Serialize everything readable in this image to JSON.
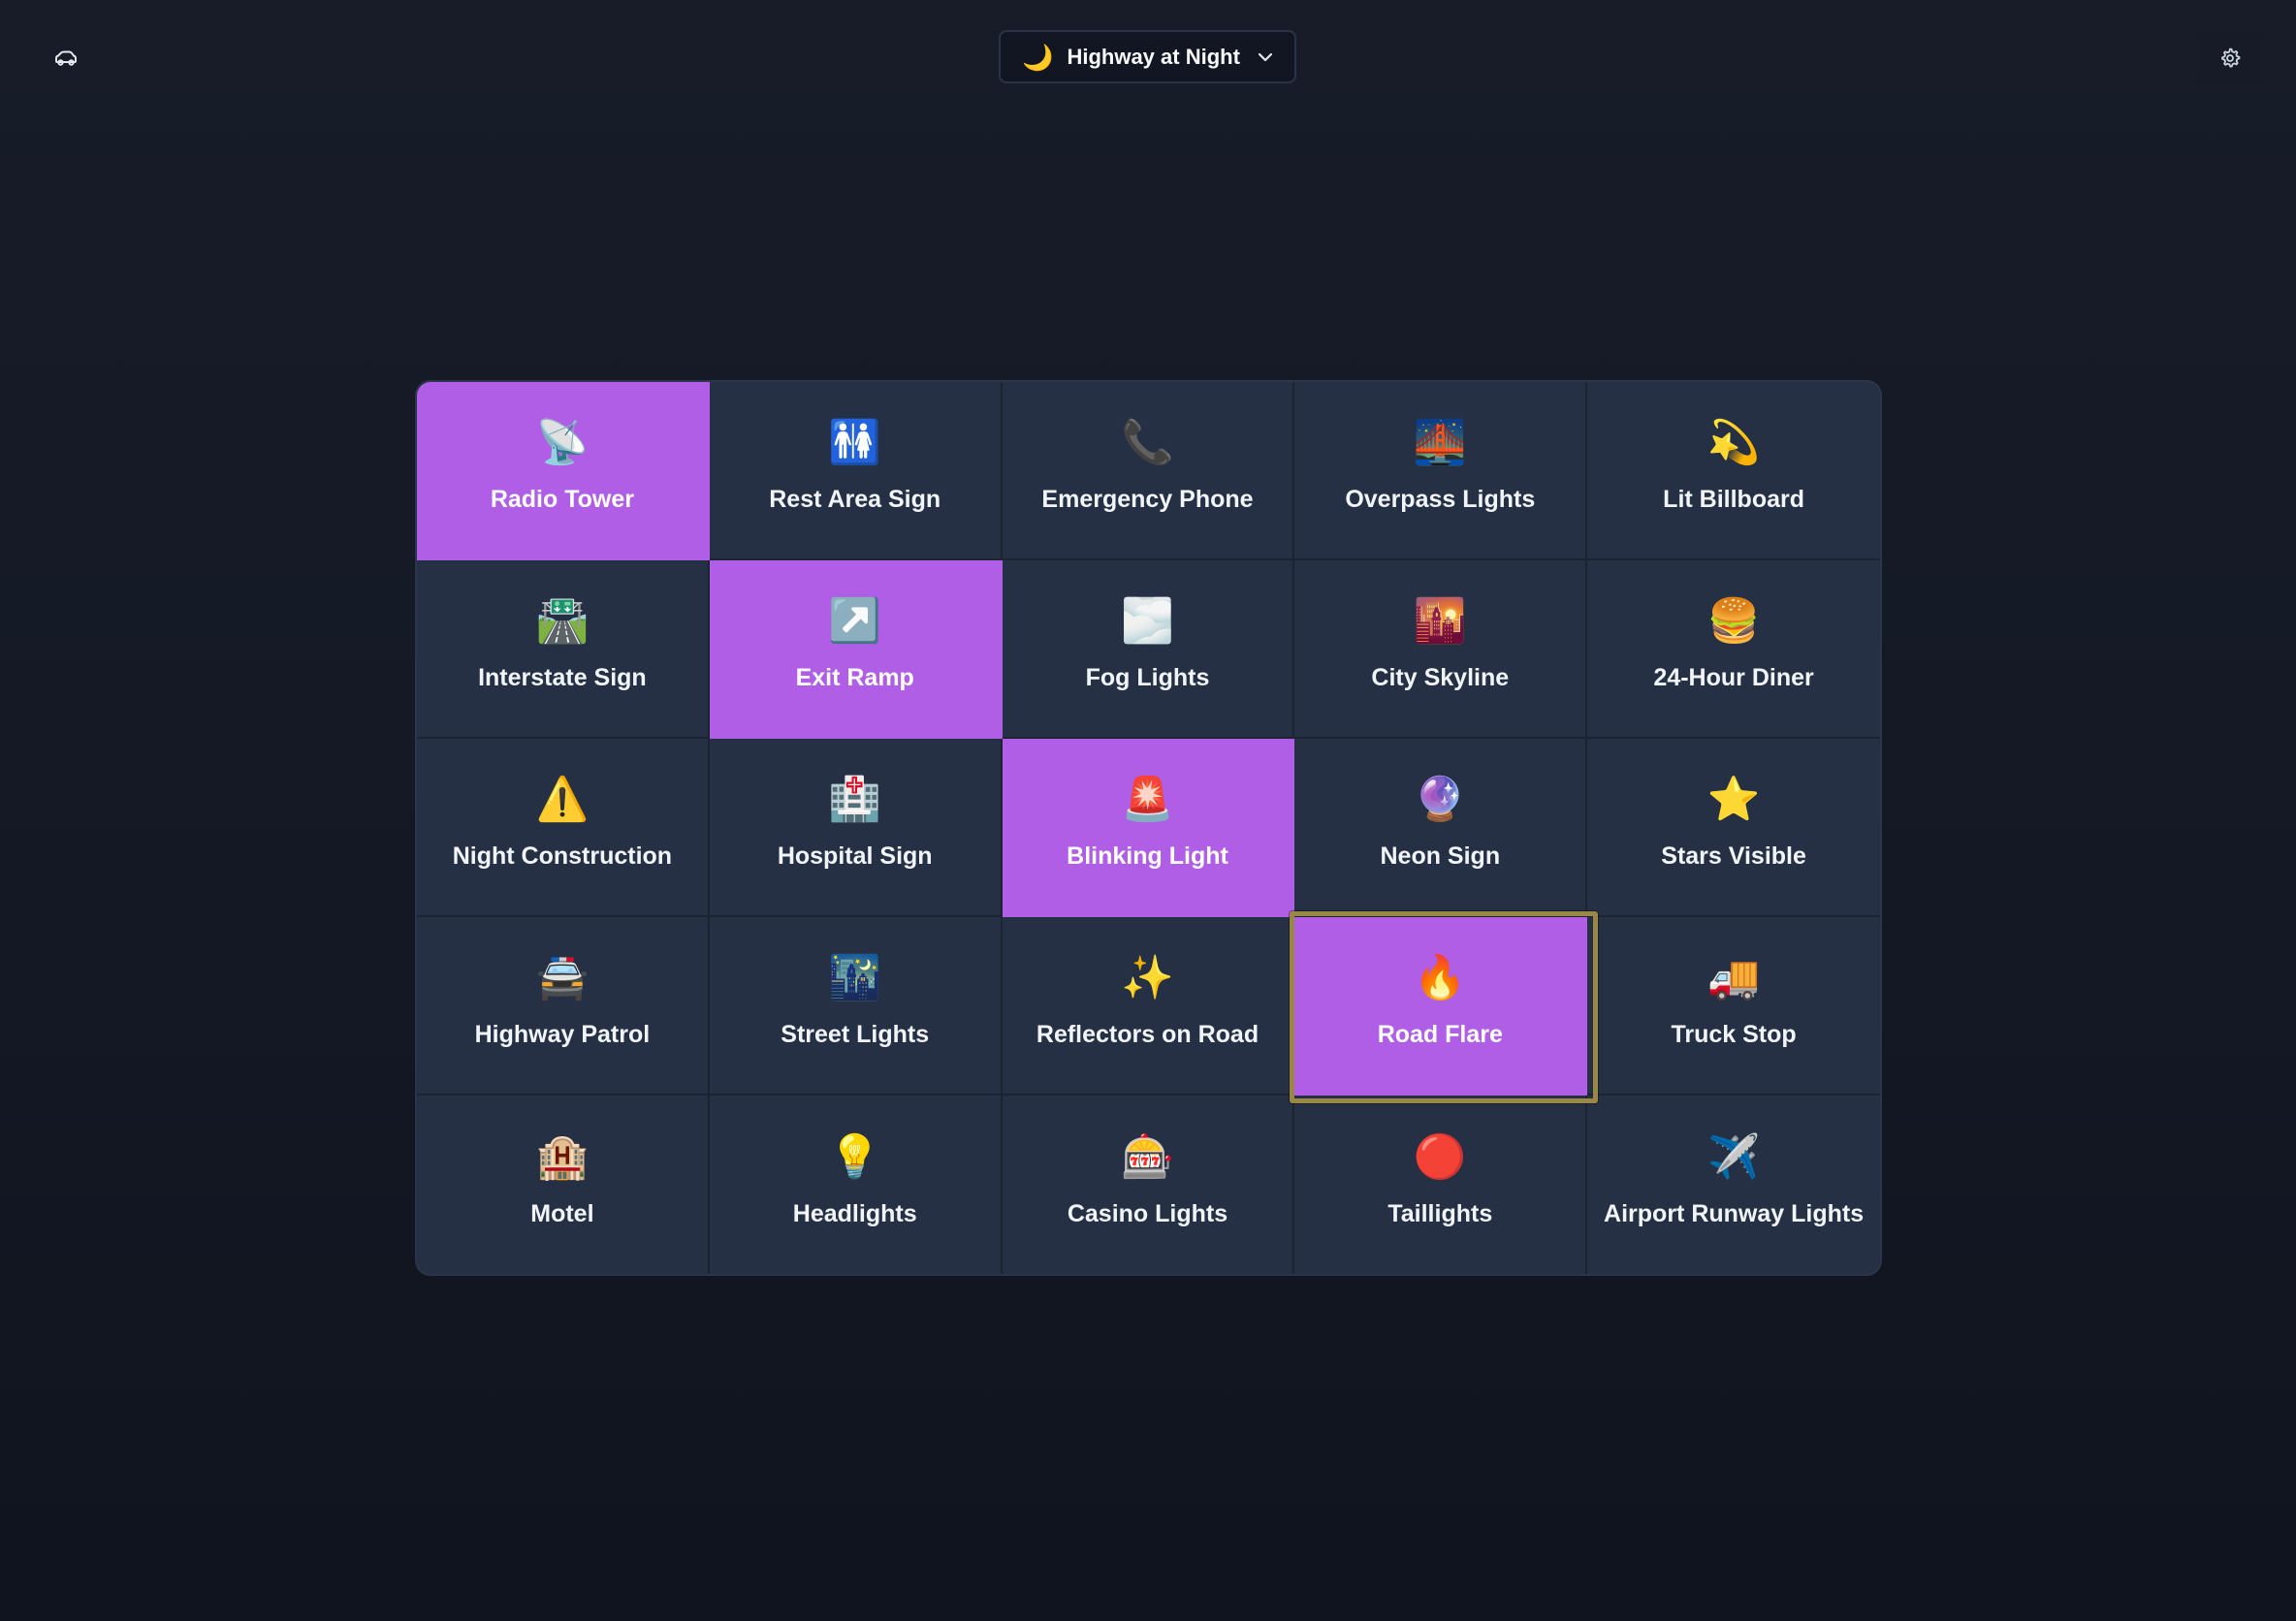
{
  "header": {
    "mode": {
      "emoji": "🌙",
      "label": "Highway at Night",
      "chevron_icon": "chevron-down-icon"
    },
    "left_icon": "car-icon",
    "right_icon": "gear-icon"
  },
  "colors": {
    "background": "#131824",
    "cell": "#253044",
    "cell_marked": "#b15ee6",
    "focus_ring": "#9a8746",
    "text": "#f1f5f9"
  },
  "board": {
    "cells": [
      {
        "emoji": "📡",
        "label": "Radio Tower",
        "marked": true
      },
      {
        "emoji": "🚻",
        "label": "Rest Area Sign",
        "marked": false
      },
      {
        "emoji": "📞",
        "label": "Emergency Phone",
        "marked": false
      },
      {
        "emoji": "🌉",
        "label": "Overpass Lights",
        "marked": false
      },
      {
        "emoji": "💫",
        "label": "Lit Billboard",
        "marked": false
      },
      {
        "emoji": "🛣️",
        "label": "Interstate Sign",
        "marked": false
      },
      {
        "emoji": "↗️",
        "label": "Exit Ramp",
        "marked": true
      },
      {
        "emoji": "🌫️",
        "label": "Fog Lights",
        "marked": false
      },
      {
        "emoji": "🌇",
        "label": "City Skyline",
        "marked": false
      },
      {
        "emoji": "🍔",
        "label": "24-Hour Diner",
        "marked": false
      },
      {
        "emoji": "⚠️",
        "label": "Night Construction",
        "marked": false
      },
      {
        "emoji": "🏥",
        "label": "Hospital Sign",
        "marked": false
      },
      {
        "emoji": "🚨",
        "label": "Blinking Light",
        "marked": true
      },
      {
        "emoji": "🔮",
        "label": "Neon Sign",
        "marked": false
      },
      {
        "emoji": "⭐",
        "label": "Stars Visible",
        "marked": false
      },
      {
        "emoji": "🚔",
        "label": "Highway Patrol",
        "marked": false
      },
      {
        "emoji": "🌃",
        "label": "Street Lights",
        "marked": false
      },
      {
        "emoji": "✨",
        "label": "Reflectors on Road",
        "marked": false
      },
      {
        "emoji": "🔥",
        "label": "Road Flare",
        "marked": true,
        "focused": true
      },
      {
        "emoji": "🚚",
        "label": "Truck Stop",
        "marked": false
      },
      {
        "emoji": "🏨",
        "label": "Motel",
        "marked": false
      },
      {
        "emoji": "💡",
        "label": "Headlights",
        "marked": false
      },
      {
        "emoji": "🎰",
        "label": "Casino Lights",
        "marked": false
      },
      {
        "emoji": "🔴",
        "label": "Taillights",
        "marked": false
      },
      {
        "emoji": "✈️",
        "label": "Airport Runway Lights",
        "marked": false
      }
    ]
  }
}
